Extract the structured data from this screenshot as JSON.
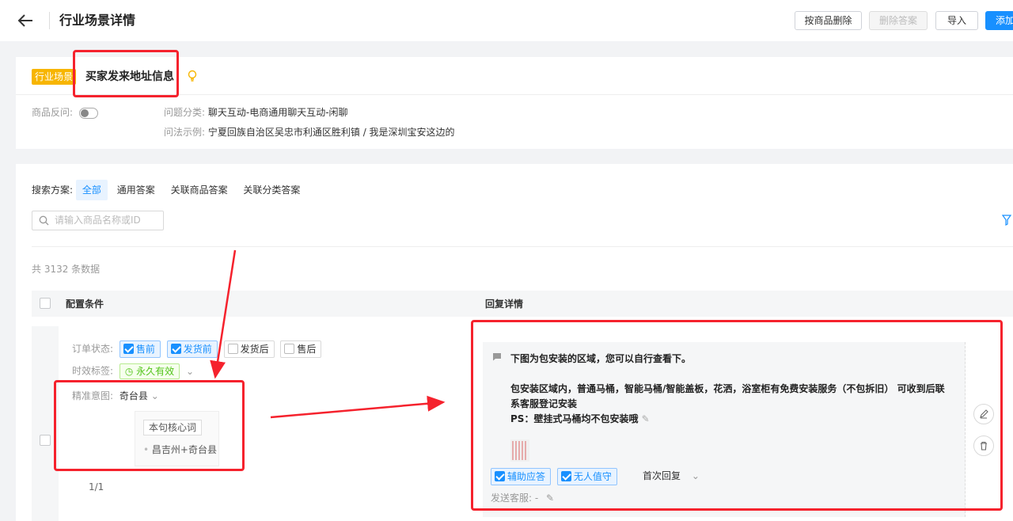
{
  "header": {
    "title": "行业场景详情",
    "btn_delete_by_goods": "按商品删除",
    "btn_delete_answer": "删除答案",
    "btn_import": "导入",
    "btn_add": "添加"
  },
  "scene": {
    "tag": "行业场景",
    "name": "买家发来地址信息",
    "goods_reverse_label": "商品反问:",
    "category_label": "问题分类:",
    "category_value": "聊天互动-电商通用聊天互动-闲聊",
    "example_label": "问法示例:",
    "example_value": "宁夏回族自治区吴忠市利通区胜利镇 / 我是深圳宝安这边的"
  },
  "filter": {
    "plan_label": "搜索方案:",
    "tabs": [
      "全部",
      "通用答案",
      "关联商品答案",
      "关联分类答案"
    ],
    "search_placeholder": "请输入商品名称或ID",
    "total": "共 3132 条数据"
  },
  "table": {
    "col_condition": "配置条件",
    "col_reply": "回复详情"
  },
  "row": {
    "order_status_label": "订单状态:",
    "order_status": [
      {
        "label": "售前",
        "checked": true
      },
      {
        "label": "发货前",
        "checked": true
      },
      {
        "label": "发货后",
        "checked": false
      },
      {
        "label": "售后",
        "checked": false
      }
    ],
    "validity_label": "时效标签:",
    "validity_value": "永久有效",
    "intent_label": "精准意图:",
    "intent_value": "奇台县",
    "keyword_title": "本句核心词",
    "keyword_item": "昌吉州+奇台县",
    "pager": "1/1",
    "reply": {
      "line1": "下图为包安装的区域，您可以自行查看下。",
      "line2": "包安装区域内，普通马桶，智能马桶/智能盖板，花洒，浴室柜有免费安装服务（不包拆旧） 可收到后联系客服登记安装",
      "line3": "PS：壁挂式马桶均不包安装哦",
      "tag_assist": "辅助应答",
      "tag_unattended": "无人值守",
      "first_reply": "首次回复",
      "send_cs": "发送客服: -"
    }
  },
  "colors": {
    "accent": "#1890ff",
    "annotation_red": "#f5222d",
    "scene_tag": "#f7b500",
    "validity_green": "#52c41a"
  }
}
